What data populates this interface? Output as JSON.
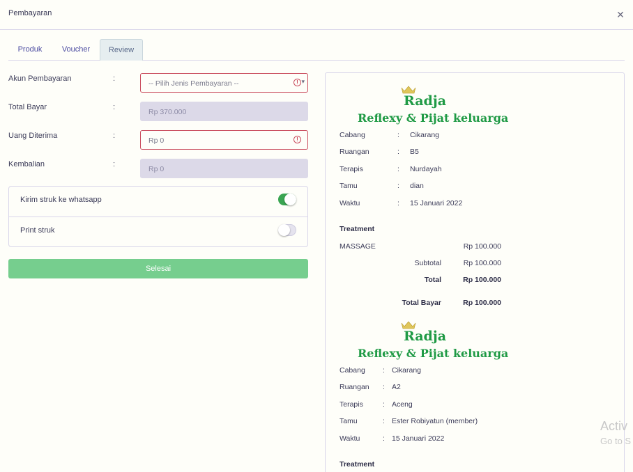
{
  "header": {
    "title": "Pembayaran",
    "close_icon": "close-icon"
  },
  "tabs": [
    {
      "label": "Produk",
      "active": false
    },
    {
      "label": "Voucher",
      "active": false
    },
    {
      "label": "Review",
      "active": true
    }
  ],
  "form": {
    "colon": ":",
    "akun": {
      "label": "Akun Pembayaran",
      "value": "-- Pilih Jenis Pembayaran --"
    },
    "total": {
      "label": "Total Bayar",
      "value": "Rp 370.000"
    },
    "uang": {
      "label": "Uang Diterima",
      "value": "Rp 0"
    },
    "kembalian": {
      "label": "Kembalian",
      "value": "Rp 0"
    }
  },
  "toggles": {
    "whatsapp": {
      "label": "Kirim struk ke whatsapp",
      "on": true
    },
    "print": {
      "label": "Print struk",
      "on": false
    }
  },
  "submit_label": "Selesai",
  "receipts": [
    {
      "brand_line1": "Radja",
      "brand_line2": "Reflexy & Pijat keluarga",
      "fields": [
        {
          "label": "Cabang",
          "value": "Cikarang"
        },
        {
          "label": "Ruangan",
          "value": "B5"
        },
        {
          "label": "Terapis",
          "value": "Nurdayah"
        },
        {
          "label": "Tamu",
          "value": "dian"
        },
        {
          "label": "Waktu",
          "value": "15 Januari 2022"
        }
      ],
      "treatment_heading": "Treatment",
      "item": {
        "name": "MASSAGE",
        "price": "Rp 100.000"
      },
      "subtotal": {
        "label": "Subtotal",
        "value": "Rp 100.000"
      },
      "total": {
        "label": "Total",
        "value": "Rp 100.000"
      },
      "total_bayar": {
        "label": "Total Bayar",
        "value": "Rp 100.000"
      }
    },
    {
      "brand_line1": "Radja",
      "brand_line2": "Reflexy & Pijat keluarga",
      "fields": [
        {
          "label": "Cabang",
          "value": "Cikarang"
        },
        {
          "label": "Ruangan",
          "value": "A2"
        },
        {
          "label": "Terapis",
          "value": "Aceng"
        },
        {
          "label": "Tamu",
          "value": "Ester Robiyatun (member)"
        },
        {
          "label": "Waktu",
          "value": "15 Januari 2022"
        }
      ],
      "treatment_heading": "Treatment"
    }
  ],
  "watermark": {
    "line1": "Activ",
    "line2": "Go to S"
  },
  "colors": {
    "accent_green": "#76ce8e",
    "brand_green": "#1f9a45",
    "error_red": "#c94a5c",
    "readonly_bg": "#dcd9e8"
  }
}
